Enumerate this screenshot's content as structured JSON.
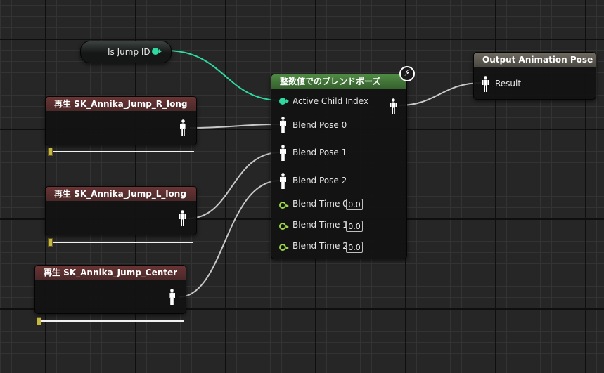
{
  "variable_node": {
    "label": "Is Jump ID"
  },
  "sequence_nodes": [
    {
      "title": "再生 SK_Annika_Jump_R_long",
      "play_rate": 0.0
    },
    {
      "title": "再生 SK_Annika_Jump_L_long",
      "play_rate": 0.0
    },
    {
      "title": "再生 SK_Annika_Jump_Center",
      "play_rate": 0.0
    }
  ],
  "blend_node": {
    "title": "整数値でのブレンドポーズ",
    "active_child_index": "Active Child Index",
    "poses": [
      "Blend Pose 0",
      "Blend Pose 1",
      "Blend Pose 2"
    ],
    "times": [
      {
        "label": "Blend Time 0",
        "value": "0.0"
      },
      {
        "label": "Blend Time 1",
        "value": "0.0"
      },
      {
        "label": "Blend Time 2",
        "value": "0.0"
      }
    ]
  },
  "output_node": {
    "title": "Output Animation Pose",
    "result": "Result"
  },
  "colors": {
    "int_pin": "#2fd9a0",
    "float_pin": "#9cd64a",
    "pose_wire": "#c8c8c8",
    "slider_handle": "#c8b840",
    "title_sequence": "#5a2f2f",
    "title_blend": "#4a7f3f",
    "title_output": "#5f5b53"
  },
  "icons": {
    "pose_pin": "person-figure-icon",
    "fast_path": "lightning-icon"
  }
}
